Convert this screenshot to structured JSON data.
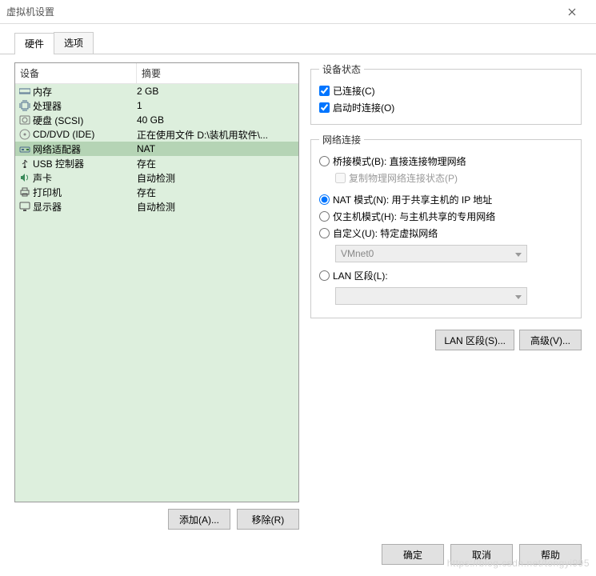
{
  "window": {
    "title": "虚拟机设置"
  },
  "tabs": {
    "hardware": "硬件",
    "options": "选项"
  },
  "columns": {
    "device": "设备",
    "summary": "摘要"
  },
  "devices": [
    {
      "icon": "memory-icon",
      "name": "内存",
      "summary": "2 GB"
    },
    {
      "icon": "cpu-icon",
      "name": "处理器",
      "summary": "1"
    },
    {
      "icon": "disk-icon",
      "name": "硬盘 (SCSI)",
      "summary": "40 GB"
    },
    {
      "icon": "cd-icon",
      "name": "CD/DVD (IDE)",
      "summary": "正在使用文件 D:\\装机用软件\\..."
    },
    {
      "icon": "network-icon",
      "name": "网络适配器",
      "summary": "NAT"
    },
    {
      "icon": "usb-icon",
      "name": "USB 控制器",
      "summary": "存在"
    },
    {
      "icon": "sound-icon",
      "name": "声卡",
      "summary": "自动检测"
    },
    {
      "icon": "printer-icon",
      "name": "打印机",
      "summary": "存在"
    },
    {
      "icon": "display-icon",
      "name": "显示器",
      "summary": "自动检测"
    }
  ],
  "selected_device_index": 4,
  "left_buttons": {
    "add": "添加(A)...",
    "remove": "移除(R)"
  },
  "status_group": {
    "legend": "设备状态",
    "connected": "已连接(C)",
    "connect_on_power": "启动时连接(O)"
  },
  "net_group": {
    "legend": "网络连接",
    "bridged": "桥接模式(B): 直接连接物理网络",
    "replicate": "复制物理网络连接状态(P)",
    "nat": "NAT 模式(N): 用于共享主机的 IP 地址",
    "hostonly": "仅主机模式(H): 与主机共享的专用网络",
    "custom": "自定义(U): 特定虚拟网络",
    "custom_value": "VMnet0",
    "lan": "LAN 区段(L):",
    "lan_value": ""
  },
  "right_buttons": {
    "lan_segments": "LAN 区段(S)...",
    "advanced": "高级(V)..."
  },
  "footer": {
    "ok": "确定",
    "cancel": "取消",
    "help": "帮助"
  },
  "watermark": "https://blog.csdn.net/tongyi995"
}
